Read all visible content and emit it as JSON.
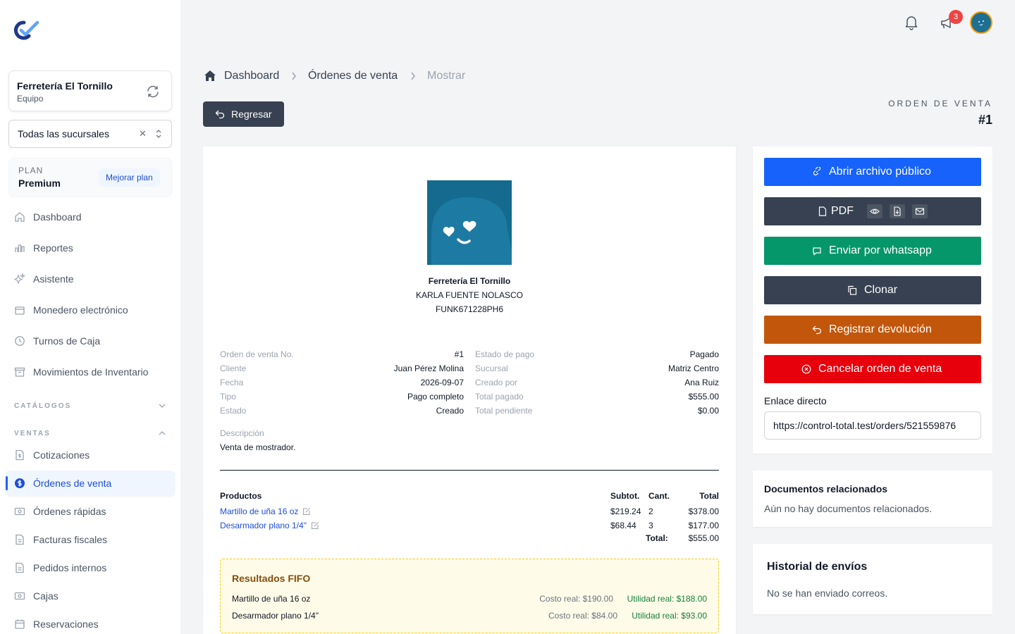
{
  "app": {
    "logo_name": "control-total-logo"
  },
  "team": {
    "name": "Ferretería El Tornillo",
    "subtitle": "Equipo"
  },
  "branch_select": {
    "value": "Todas las sucursales"
  },
  "plan": {
    "label": "PLAN",
    "name": "Premium",
    "upgrade_label": "Mejorar plan"
  },
  "nav": {
    "dashboard": "Dashboard",
    "reportes": "Reportes",
    "asistente": "Asistente",
    "monedero": "Monedero electrónico",
    "turnos": "Turnos de Caja",
    "movimientos": "Movimientos de Inventario",
    "section_catalogos": "CATÁLOGOS",
    "section_ventas": "VENTAS",
    "cotizaciones": "Cotizaciones",
    "ordenes_venta": "Órdenes de venta",
    "ordenes_rapidas": "Órdenes rápidas",
    "facturas": "Facturas fiscales",
    "pedidos": "Pedidos internos",
    "cajas": "Cajas",
    "reservaciones": "Reservaciones"
  },
  "topbar": {
    "notification_count": "3"
  },
  "breadcrumb": {
    "home": "Dashboard",
    "parent": "Órdenes de venta",
    "current": "Mostrar"
  },
  "back_button": "Regresar",
  "order_header": {
    "label": "ORDEN DE VENTA",
    "number": "#1"
  },
  "business": {
    "name": "Ferretería El Tornillo",
    "owner": "KARLA FUENTE NOLASCO",
    "rfc": "FUNK671228PH6"
  },
  "details_left": [
    {
      "k": "Orden de venta No.",
      "v": "#1"
    },
    {
      "k": "Cliente",
      "v": "Juan Pérez Molina"
    },
    {
      "k": "Fecha",
      "v": "2026-09-07"
    },
    {
      "k": "Tipo",
      "v": "Pago completo"
    },
    {
      "k": "Estado",
      "v": "Creado"
    }
  ],
  "details_right": [
    {
      "k": "Estado de pago",
      "v": "Pagado"
    },
    {
      "k": "Sucursal",
      "v": "Matriz Centro"
    },
    {
      "k": "Creado por",
      "v": "Ana Ruiz"
    },
    {
      "k": "Total pagado",
      "v": "$555.00"
    },
    {
      "k": "Total pendiente",
      "v": "$0.00"
    }
  ],
  "description": {
    "label": "Descripción",
    "value": "Venta de mostrador."
  },
  "products": {
    "headers": {
      "name": "Productos",
      "subtotal": "Subtot.",
      "qty": "Cant.",
      "total": "Total"
    },
    "rows": [
      {
        "name": "Martillo de uña 16 oz",
        "subtotal": "$219.24",
        "qty": "2",
        "total": "$378.00"
      },
      {
        "name": "Desarmador plano 1/4\"",
        "subtotal": "$68.44",
        "qty": "3",
        "total": "$177.00"
      }
    ],
    "total_label": "Total:",
    "total_value": "$555.00"
  },
  "fifo": {
    "title": "Resultados FIFO",
    "rows": [
      {
        "name": "Martillo de uña 16 oz",
        "cost": "Costo real: $190.00",
        "util": "Utilidad real: $188.00"
      },
      {
        "name": "Desarmador plano 1/4\"",
        "cost": "Costo real: $84.00",
        "util": "Utilidad real: $93.00"
      }
    ]
  },
  "actions": {
    "open_public": "Abrir archivo público",
    "pdf": "PDF",
    "whatsapp": "Enviar por whatsapp",
    "clone": "Clonar",
    "return": "Registrar devolución",
    "cancel": "Cancelar orden de venta"
  },
  "direct_link": {
    "label": "Enlace directo",
    "value": "https://control-total.test/orders/521559876"
  },
  "related_docs": {
    "title": "Documentos relacionados",
    "empty": "Aún no hay documentos relacionados."
  },
  "send_history": {
    "title": "Historial de envíos",
    "empty": "No se han enviado correos."
  },
  "colors": {
    "primary": "#1d4ed8",
    "open_btn": "#1662fa",
    "dark_btn": "#374151",
    "whatsapp": "#059669",
    "return": "#c2570c",
    "cancel": "#e7000b"
  }
}
